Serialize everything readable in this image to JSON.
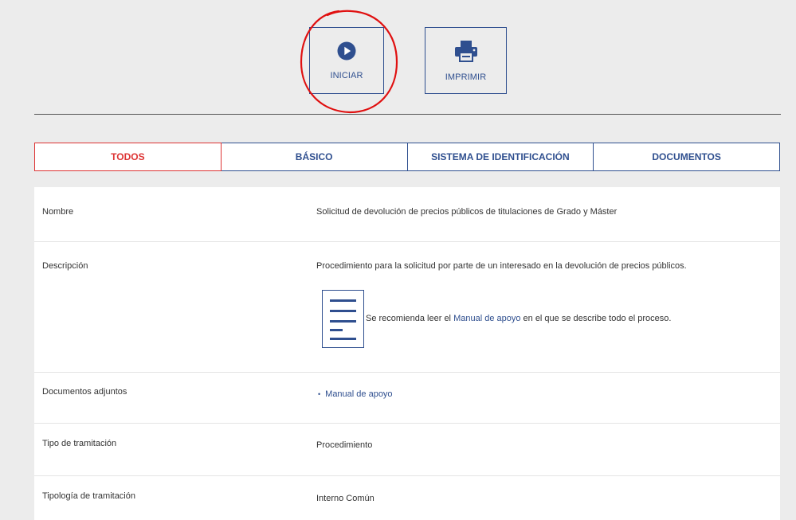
{
  "actions": {
    "iniciar_label": "INICIAR",
    "imprimir_label": "IMPRIMIR"
  },
  "tabs": [
    {
      "label": "TODOS",
      "active": true
    },
    {
      "label": "BÁSICO",
      "active": false
    },
    {
      "label": "SISTEMA DE IDENTIFICACIÓN",
      "active": false
    },
    {
      "label": "DOCUMENTOS",
      "active": false
    }
  ],
  "details": {
    "nombre": {
      "label": "Nombre",
      "value": "Solicitud de devolución de precios públicos de titulaciones de Grado y Máster"
    },
    "descripcion": {
      "label": "Descripción",
      "value": "Procedimiento para la solicitud por parte de un interesado en la devolución de precios públicos.",
      "note_prefix": "Se recomienda leer el ",
      "note_link": "Manual de apoyo",
      "note_suffix": " en el que se describe todo el proceso."
    },
    "documentos": {
      "label": "Documentos adjuntos",
      "bullet": "•",
      "link": "Manual de apoyo"
    },
    "tipo": {
      "label": "Tipo de tramitación",
      "value": "Procedimiento"
    },
    "tipologia": {
      "label": "Tipología de tramitación",
      "value": "Interno Común"
    }
  },
  "colors": {
    "accent_blue": "#2f4f8f",
    "active_tab_red": "#d33333",
    "highlight_circle": "#e01010"
  },
  "icons": {
    "iniciar": "play-circle-icon",
    "imprimir": "printer-icon",
    "note": "document-lines-icon"
  }
}
